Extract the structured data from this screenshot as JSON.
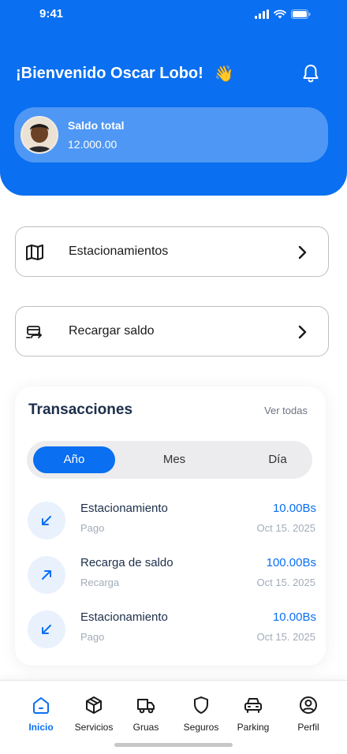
{
  "status_bar": {
    "time": "9:41"
  },
  "header": {
    "welcome": "¡Bienvenido Oscar Lobo!",
    "wave_emoji": "👋"
  },
  "balance": {
    "label": "Saldo total",
    "value": "12.000.00"
  },
  "menu": [
    {
      "label": "Estacionamientos",
      "icon": "map-icon"
    },
    {
      "label": "Recargar saldo",
      "icon": "recharge-icon"
    }
  ],
  "transactions": {
    "title": "Transacciones",
    "view_all": "Ver todas",
    "tabs": [
      {
        "label": "Año",
        "active": true
      },
      {
        "label": "Mes",
        "active": false
      },
      {
        "label": "Día",
        "active": false
      }
    ],
    "items": [
      {
        "name": "Estacionamiento",
        "type": "Pago",
        "amount": "10.00Bs",
        "date": "Oct 15. 2025",
        "direction": "down-left"
      },
      {
        "name": "Recarga de saldo",
        "type": "Recarga",
        "amount": "100.00Bs",
        "date": "Oct 15. 2025",
        "direction": "up-right"
      },
      {
        "name": "Estacionamiento",
        "type": "Pago",
        "amount": "10.00Bs",
        "date": "Oct 15. 2025",
        "direction": "down-left"
      }
    ]
  },
  "nav": [
    {
      "label": "Inicio",
      "icon": "home-icon",
      "active": true
    },
    {
      "label": "Servicios",
      "icon": "box-icon",
      "active": false
    },
    {
      "label": "Gruas",
      "icon": "truck-icon",
      "active": false
    },
    {
      "label": "Seguros",
      "icon": "shield-icon",
      "active": false
    },
    {
      "label": "Parking",
      "icon": "car-icon",
      "active": false
    },
    {
      "label": "Perfil",
      "icon": "user-icon",
      "active": false
    }
  ],
  "colors": {
    "primary": "#0a6ff0",
    "title": "#1c2e4a",
    "muted": "#a3acb9"
  }
}
